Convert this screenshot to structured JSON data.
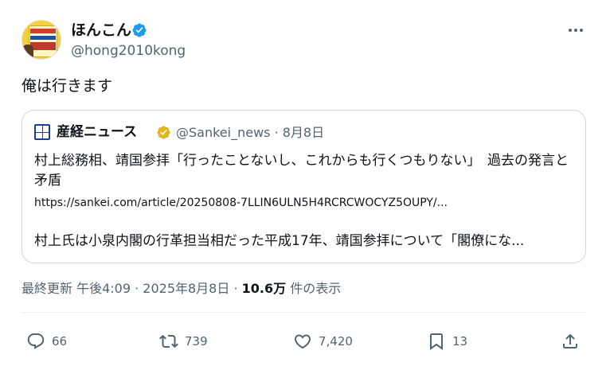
{
  "author": {
    "display_name": "ほんこん",
    "handle": "@hong2010kong",
    "verified_color": "#1d9bf0"
  },
  "tweet": {
    "text": "俺は行きます"
  },
  "quote": {
    "name": "産経ニュース",
    "handle_date": "@Sankei_news · 8月8日",
    "badge_color": "#e2b719",
    "body": "村上総務相、靖国参拝「行ったことないし、これからも行くつもりない」　過去の発言と矛盾",
    "link": "https://sankei.com/article/20250808-7LLIN6ULN5H4RCRCWOCYZ5OUPY/...",
    "excerpt": "村上氏は小泉内閣の行革担当相だった平成17年、靖国参拝について「閣僚にな..."
  },
  "meta": {
    "updated": "最終更新 午後4:09 · 2025年8月8日 · ",
    "views": "10.6万",
    "views_suffix": " 件の表示"
  },
  "actions": {
    "reply": "66",
    "retweet": "739",
    "like": "7,420",
    "bookmark": "13"
  },
  "icons": [
    "verified-icon",
    "more-icon",
    "reply-icon",
    "retweet-icon",
    "like-icon",
    "bookmark-icon",
    "share-icon"
  ]
}
